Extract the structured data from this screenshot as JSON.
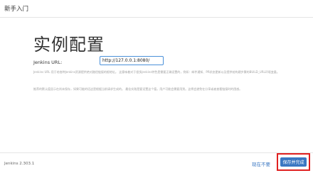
{
  "header": {
    "title": "新手入门"
  },
  "main": {
    "title": "实例配置",
    "url_label": "Jenkins URL:",
    "url_value": "http://127.0.0.1:8080/",
    "desc_1": "Jenkins URL 用于给各种Jenkins资源提供绝对路径链接的根地址。 这意味着对于很多Jenkins特色是需要正确设置的，例如：邮件通知、PR状态更新以及提供给构建步骤的BUILD_URL环境变量。",
    "desc_2": "推荐的默认值显示在尚未保存，如果可能的话这是根据当前请求生成的。 最佳实践是要设置这个值，用户可能会需要用到。这将会避免在分享或者查看链接时的困惑。"
  },
  "footer": {
    "version": "Jenkins 2.303.1",
    "skip_label": "现在不要",
    "save_label": "保存并完成"
  },
  "colors": {
    "accent": "#3a77c2",
    "highlight": "#e02020"
  }
}
